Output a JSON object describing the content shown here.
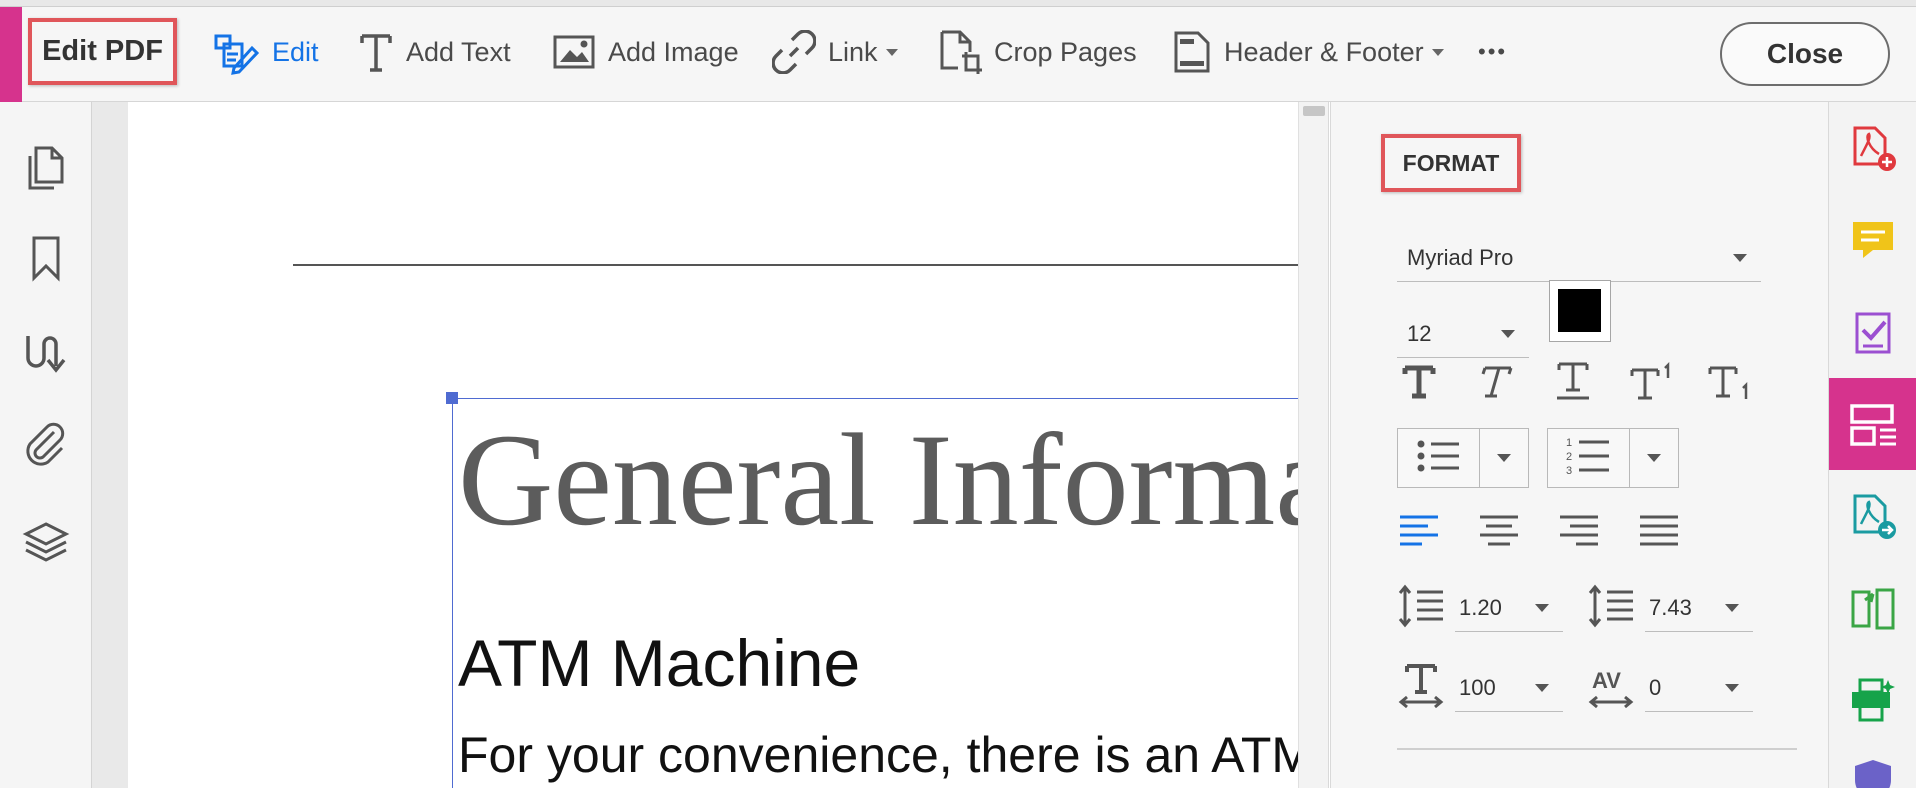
{
  "toolbar": {
    "mode_label": "Edit PDF",
    "tools": {
      "edit": "Edit",
      "add_text": "Add Text",
      "add_image": "Add Image",
      "link": "Link",
      "crop_pages": "Crop Pages",
      "header_footer": "Header & Footer",
      "more": "•••"
    },
    "close_label": "Close",
    "accent_color": "#d6338d",
    "highlight_color": "#e0565a",
    "edit_color": "#1473e6"
  },
  "left_rail": {
    "icons": [
      "pages-icon",
      "bookmark-icon",
      "signature-icon",
      "attachment-icon",
      "layers-icon"
    ]
  },
  "document": {
    "title": "General Informa",
    "heading": "ATM Machine",
    "body": "For your convenience, there is an ATM"
  },
  "format_panel": {
    "title": "FORMAT",
    "font_family": "Myriad Pro",
    "font_size": "12",
    "text_color": "#000000",
    "line_spacing": "1.20",
    "paragraph_spacing": "7.43",
    "horizontal_scaling": "100",
    "character_spacing": "0"
  },
  "right_strip": {
    "icons": [
      "create-pdf-icon",
      "comment-icon",
      "fill-sign-icon",
      "edit-pdf-icon",
      "export-pdf-icon",
      "organize-pages-icon",
      "print-production-icon",
      "protect-icon"
    ],
    "active": "edit-pdf-icon"
  }
}
